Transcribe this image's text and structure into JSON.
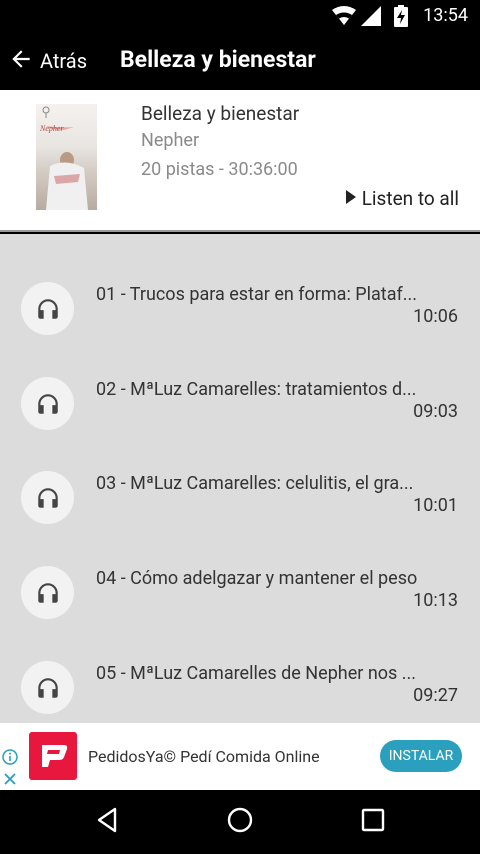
{
  "status_bar": {
    "time": "13:54",
    "icons": [
      "wifi-icon",
      "signal-icon",
      "battery-charging-icon"
    ]
  },
  "app_bar": {
    "back_label": "Atrás",
    "title": "Belleza y bienestar"
  },
  "album": {
    "title": "Belleza y bienestar",
    "author": "Nepher",
    "meta": "20 pistas - 30:36:00",
    "listen_all": "Listen to all",
    "cover_text": "Nepher"
  },
  "tracks": [
    {
      "title": "01 - Trucos para estar en forma: Plataf...",
      "duration": "10:06"
    },
    {
      "title": "02 - MªLuz Camarelles: tratamientos d...",
      "duration": "09:03"
    },
    {
      "title": "03 - MªLuz Camarelles: celulitis, el gra...",
      "duration": "10:01"
    },
    {
      "title": "04 - Cómo adelgazar y mantener el peso",
      "duration": "10:13"
    },
    {
      "title": "05 - MªLuz Camarelles de Nepher nos ...",
      "duration": "09:27"
    }
  ],
  "ad": {
    "text": "PedidosYa© Pedí Comida Online",
    "button": "INSTALAR"
  },
  "colors": {
    "app_bar": "#000000",
    "list_bg": "#dcdcdc",
    "install_button": "#2a9fbe",
    "ad_logo": "#e8173d"
  }
}
